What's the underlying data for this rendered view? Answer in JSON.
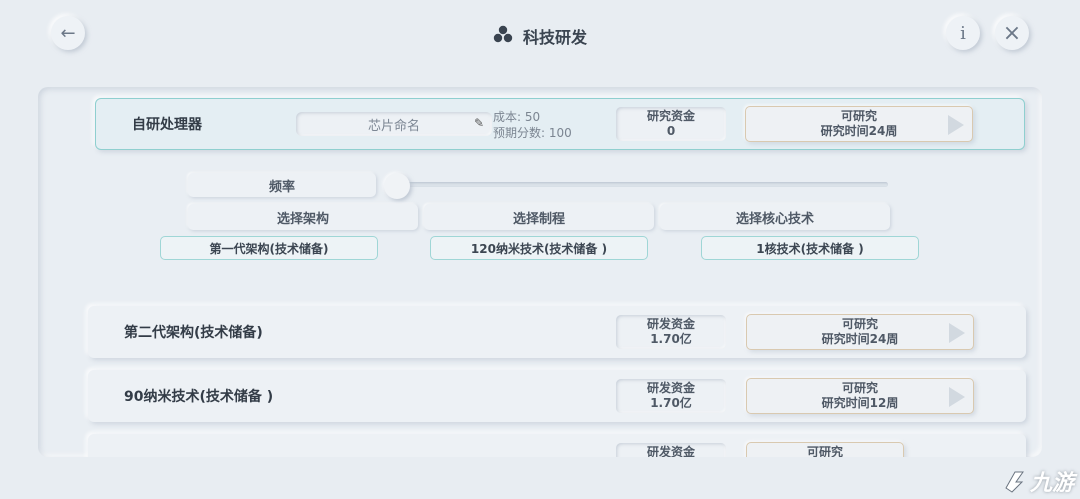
{
  "header": {
    "title": "科技研发",
    "back_icon": "←",
    "info_icon": "i",
    "close_icon": "×"
  },
  "chip": {
    "name": "自研处理器",
    "name_placeholder": "芯片命名",
    "cost_line": "成本: 50",
    "score_line": "预期分数: 100",
    "fund_label": "研究资金",
    "fund_value": "0",
    "status": "可研究",
    "time": "研究时间24周"
  },
  "frequency": {
    "label": "频率",
    "level": 0
  },
  "selectors": [
    {
      "header": "选择架构",
      "value": "第一代架构(技术储备)"
    },
    {
      "header": "选择制程",
      "value": "120纳米技术(技术储备 )"
    },
    {
      "header": "选择核心技术",
      "value": "1核技术(技术储备 )"
    }
  ],
  "research_items": [
    {
      "name": "第二代架构(技术储备)",
      "fund_label": "研发资金",
      "fund_value": "1.70亿",
      "status": "可研究",
      "time": "研究时间24周"
    },
    {
      "name": "90纳米技术(技术储备 )",
      "fund_label": "研发资金",
      "fund_value": "1.70亿",
      "status": "可研究",
      "time": "研究时间12周"
    },
    {
      "name": "",
      "fund_label": "研发资金",
      "fund_value": "",
      "status": "可研究",
      "time": ""
    }
  ],
  "watermark": {
    "text": "九游"
  }
}
